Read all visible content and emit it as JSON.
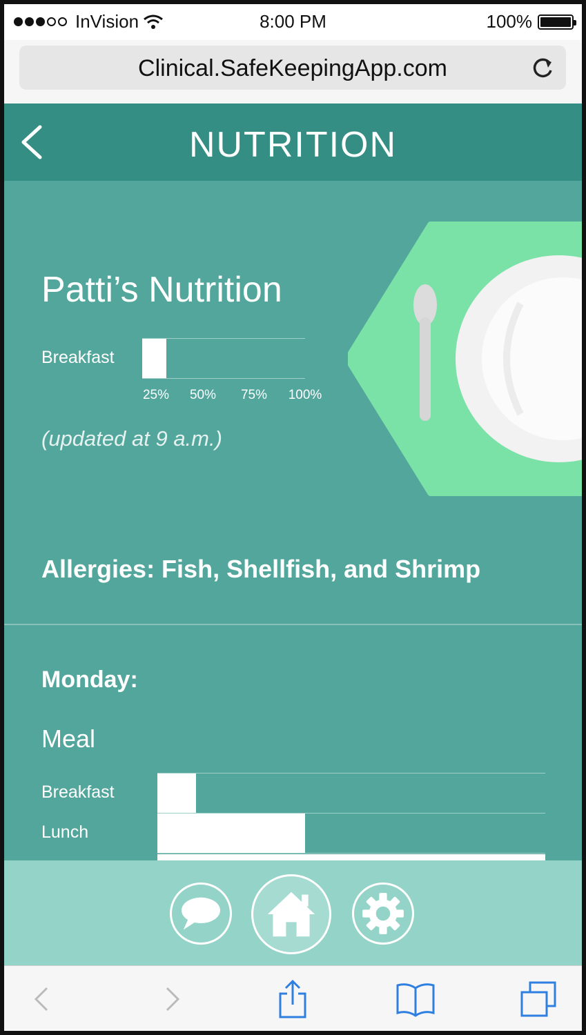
{
  "status_bar": {
    "carrier": "InVision",
    "time": "8:00 PM",
    "battery": "100%"
  },
  "browser": {
    "url": "Clinical.SafeKeepingApp.com"
  },
  "header": {
    "title": "NUTRITION"
  },
  "summary": {
    "title": "Patti’s Nutrition",
    "chart": {
      "type": "bar",
      "categories": [
        "Breakfast"
      ],
      "values": [
        0.15
      ],
      "tick_labels": [
        "25%",
        "50%",
        "75%",
        "100%"
      ]
    },
    "updated": "(updated at 9 a.m.)"
  },
  "allergies": "Allergies: Fish, Shellfish, and Shrimp",
  "day": {
    "label": "Monday:",
    "column_header": "Meal",
    "meals": [
      {
        "label": "Breakfast",
        "value": 0.1
      },
      {
        "label": "Lunch",
        "value": 0.38
      },
      {
        "label": "",
        "value": 1.0
      }
    ]
  },
  "colors": {
    "header": "#358e84",
    "content": "#53a69c",
    "nav": "#93d3c8",
    "plate_bg": "#7be2a7",
    "toolbar_icon": "#2f7fe0"
  },
  "icons": {
    "nav": [
      "chat-bubble-icon",
      "home-icon",
      "gear-icon"
    ],
    "toolbar": [
      "back-arrow-icon",
      "forward-arrow-icon",
      "share-icon",
      "bookmarks-icon",
      "tabs-icon"
    ]
  }
}
